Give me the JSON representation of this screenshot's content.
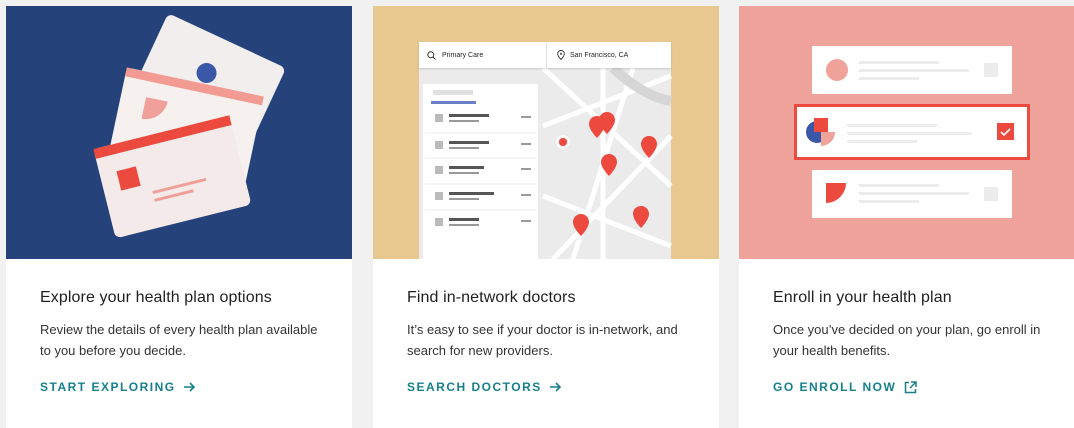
{
  "colors": {
    "card0_hero": "#25427a",
    "card1_hero": "#e8c88f",
    "card2_hero": "#f0a39a",
    "link": "#17808a",
    "accent_red": "#ec4a3e"
  },
  "cards": [
    {
      "title": "Explore your health plan options",
      "description": "Review the details of every health plan available to you before you decide.",
      "link_label": "START EXPLORING",
      "link_icon": "arrow-right-icon"
    },
    {
      "title": "Find in-network doctors",
      "description": "It’s easy to see if your doctor is in-network, and search for new providers.",
      "link_label": "SEARCH DOCTORS",
      "link_icon": "arrow-right-icon",
      "mock_search": {
        "query": "Primary Care",
        "location": "San Francisco, CA"
      }
    },
    {
      "title": "Enroll in your health plan",
      "description": "Once you’ve decided on your plan, go enroll in your health benefits.",
      "link_label": "GO ENROLL NOW",
      "link_icon": "external-link-icon"
    }
  ]
}
